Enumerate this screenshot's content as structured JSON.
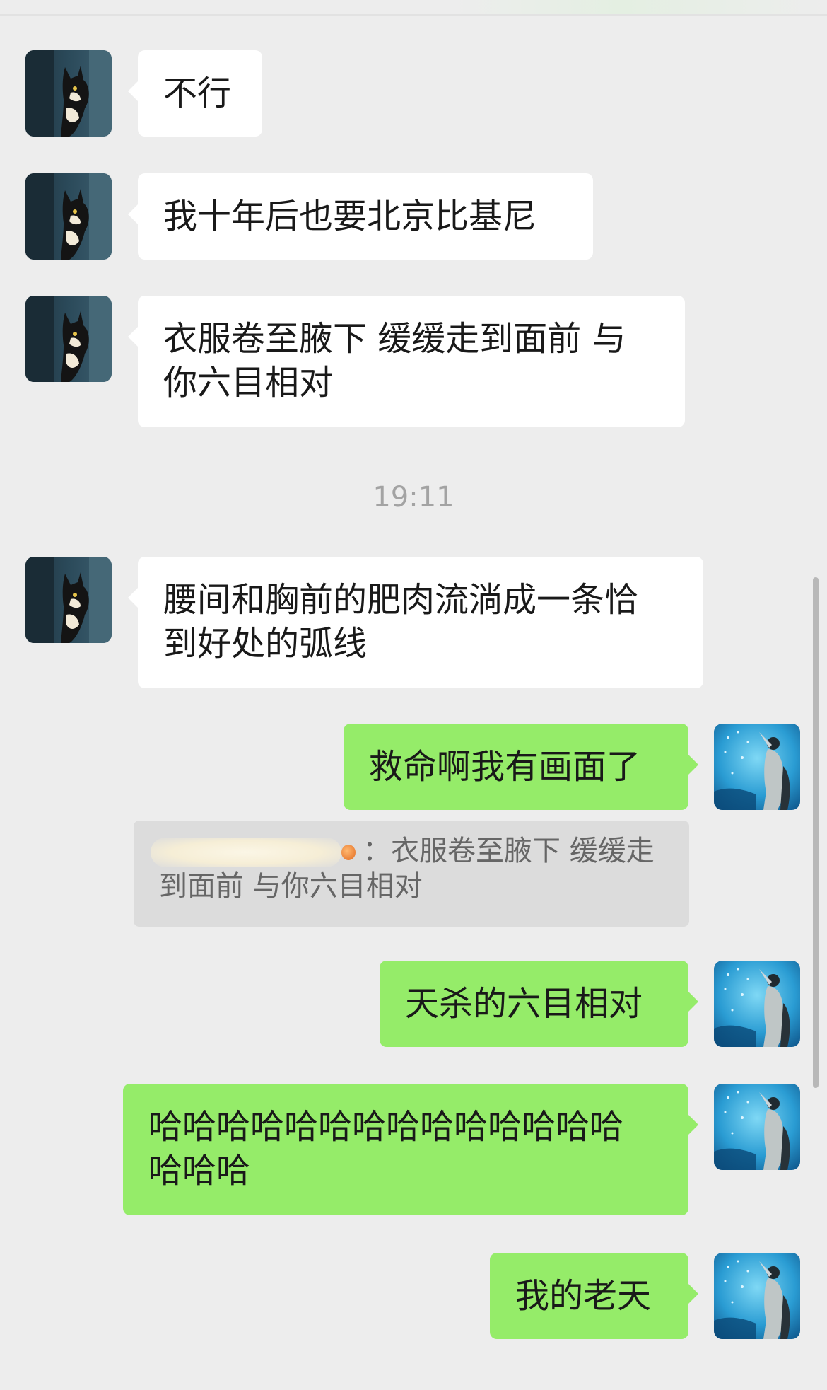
{
  "messages": [
    {
      "side": "left",
      "text": "不行"
    },
    {
      "side": "left",
      "text": "我十年后也要北京比基尼"
    },
    {
      "side": "left",
      "text": "衣服卷至腋下 缓缓走到面前 与\n你六目相对"
    },
    {
      "side": "left",
      "text": "腰间和胸前的肥肉流淌成一条恰\n到好处的弧线"
    },
    {
      "side": "right",
      "text": "救命啊我有画面了"
    },
    {
      "side": "right",
      "text": "天杀的六目相对"
    },
    {
      "side": "right",
      "text": "哈哈哈哈哈哈哈哈哈哈哈哈哈哈\n哈哈哈"
    },
    {
      "side": "right",
      "text": "我的老天"
    }
  ],
  "timestamp": "19:11",
  "quote": {
    "separator": "：",
    "text": "衣服卷至腋下 缓缓走\n到面前 与你六目相对"
  },
  "avatars": {
    "contact": "cat-peeking-avatar",
    "self": "underwater-aquarium-avatar"
  },
  "colors": {
    "background": "#ededed",
    "incoming_bubble": "#ffffff",
    "outgoing_bubble": "#95ec69",
    "timestamp": "#a3a3a3",
    "quote_bg": "#dcdcdc"
  }
}
